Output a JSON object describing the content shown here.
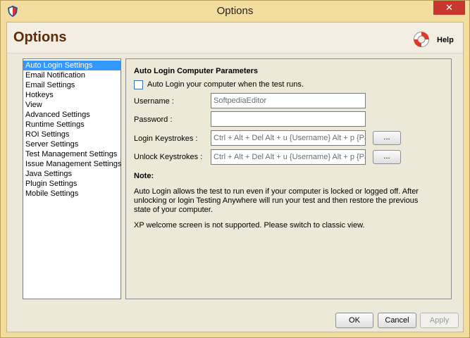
{
  "window": {
    "title": "Options",
    "close_label": "✕"
  },
  "dialog": {
    "title": "Options",
    "help_label": "Help"
  },
  "nav": {
    "items": [
      {
        "label": "Auto Login Settings",
        "selected": true
      },
      {
        "label": "Email Notification"
      },
      {
        "label": "Email Settings"
      },
      {
        "label": "Hotkeys"
      },
      {
        "label": "View"
      },
      {
        "label": "Advanced Settings"
      },
      {
        "label": "Runtime Settings"
      },
      {
        "label": "ROI Settings"
      },
      {
        "label": "Server Settings"
      },
      {
        "label": "Test Management Settings"
      },
      {
        "label": "Issue Management Settings"
      },
      {
        "label": "Java Settings"
      },
      {
        "label": "Plugin Settings"
      },
      {
        "label": "Mobile Settings"
      }
    ]
  },
  "panel": {
    "section_title": "Auto Login Computer Parameters",
    "auto_login_checkbox": {
      "label": "Auto Login your computer when the test runs.",
      "checked": false
    },
    "username": {
      "label": "Username :",
      "value": "SoftpediaEditor"
    },
    "password": {
      "label": "Password :",
      "value": ""
    },
    "login_keystrokes": {
      "label": "Login Keystrokes :",
      "value": "Ctrl + Alt + Del Alt + u {Username} Alt + p {Pa",
      "button": "..."
    },
    "unlock_keystrokes": {
      "label": "Unlock Keystrokes :",
      "value": "Ctrl + Alt + Del Alt + u {Username} Alt + p {Pa",
      "button": "..."
    },
    "note_title": "Note:",
    "note_text": "Auto Login allows the test to run even if your computer is locked or logged off. After unlocking or login Testing Anywhere will run your test and then restore the previous state of your computer.",
    "note_text2": "XP welcome screen is not supported. Please switch to classic view."
  },
  "footer": {
    "ok": "OK",
    "cancel": "Cancel",
    "apply": "Apply"
  },
  "colors": {
    "frame": "#f3dd9e",
    "title_brown": "#5c2d0b",
    "selection": "#3399ff",
    "close_red": "#c7372f"
  }
}
